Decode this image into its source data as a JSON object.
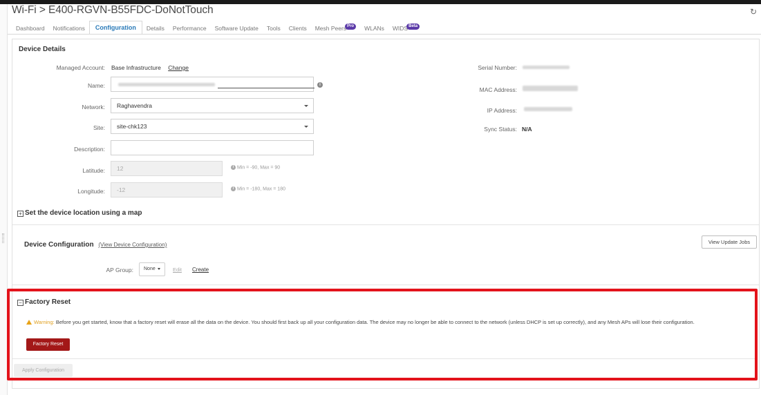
{
  "header": {
    "title": "Wi-Fi > E400-RGVN-B55FDC-DoNotTouch",
    "refresh_icon": "refresh-icon"
  },
  "tabs": [
    {
      "label": "Dashboard"
    },
    {
      "label": "Notifications"
    },
    {
      "label": "Configuration",
      "active": true
    },
    {
      "label": "Details"
    },
    {
      "label": "Performance"
    },
    {
      "label": "Software Update"
    },
    {
      "label": "Tools"
    },
    {
      "label": "Clients"
    },
    {
      "label": "Mesh Peers",
      "badge": "Pro"
    },
    {
      "label": "WLANs"
    },
    {
      "label": "WIDS",
      "badge": "Beta"
    }
  ],
  "device_details": {
    "title": "Device Details",
    "managed_account_label": "Managed Account:",
    "managed_account_value": "Base Infrastructure",
    "change_link": "Change",
    "name_label": "Name:",
    "network_label": "Network:",
    "network_value": "Raghavendra",
    "site_label": "Site:",
    "site_value": "site-chk123",
    "description_label": "Description:",
    "description_value": "",
    "latitude_label": "Latitude:",
    "latitude_value": "12",
    "latitude_hint": "Min = -90, Max = 90",
    "longitude_label": "Longitude:",
    "longitude_value": "-12",
    "longitude_hint": "Min = -180, Max = 180",
    "serial_label": "Serial Number:",
    "mac_label": "MAC Address:",
    "ip_label": "IP Address:",
    "sync_label": "Sync Status:",
    "sync_value": "N/A"
  },
  "map_section": {
    "title": "Set the device location using a map",
    "expand_symbol": "+"
  },
  "device_configuration": {
    "title": "Device Configuration",
    "view_link": "(View Device Configuration)",
    "view_update_jobs": "View Update Jobs",
    "ap_group_label": "AP Group:",
    "ap_group_value": "None",
    "edit_link": "Edit",
    "create_link": "Create"
  },
  "factory_reset": {
    "title": "Factory Reset",
    "collapse_symbol": "−",
    "warning_label": "Warning:",
    "warning_text": " Before you get started, know that a factory reset will erase all the data on the device. You should first back up all your configuration data. The device may no longer be able to connect to the network (unless DHCP is set up correctly), and any Mesh APs will lose their configuration.",
    "button": "Factory Reset"
  },
  "footer": {
    "apply_button": "Apply Configuration"
  },
  "colors": {
    "accent": "#2a7ab8",
    "danger": "#a31818",
    "highlight_outline": "#e3131b",
    "warning": "#e8a317",
    "badge": "#5b3aa8"
  }
}
